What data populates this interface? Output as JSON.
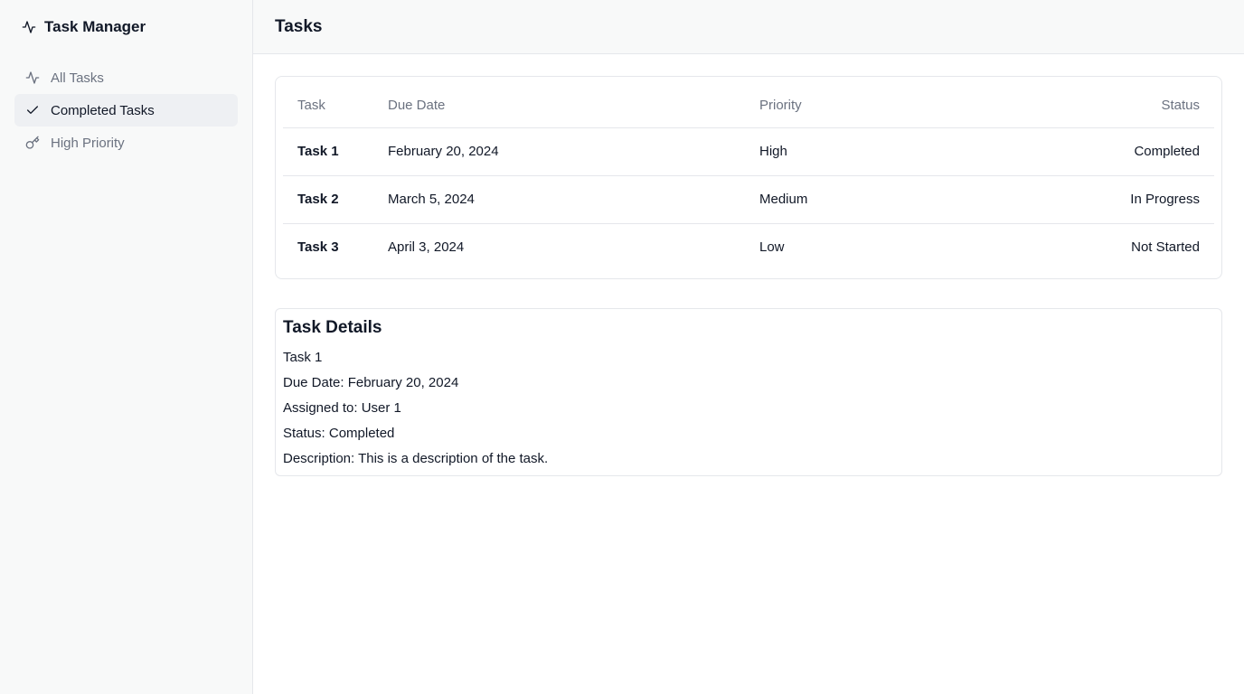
{
  "app": {
    "title": "Task Manager",
    "logo_icon": "activity-icon"
  },
  "sidebar": {
    "items": [
      {
        "label": "All Tasks",
        "icon": "activity-icon",
        "active": false
      },
      {
        "label": "Completed Tasks",
        "icon": "check-icon",
        "active": true
      },
      {
        "label": "High Priority",
        "icon": "key-icon",
        "active": false
      }
    ]
  },
  "header": {
    "title": "Tasks"
  },
  "table": {
    "columns": [
      "Task",
      "Due Date",
      "Priority",
      "Status"
    ],
    "rows": [
      {
        "task": "Task 1",
        "due": "February 20, 2024",
        "priority": "High",
        "status": "Completed"
      },
      {
        "task": "Task 2",
        "due": "March 5, 2024",
        "priority": "Medium",
        "status": "In Progress"
      },
      {
        "task": "Task 3",
        "due": "April 3, 2024",
        "priority": "Low",
        "status": "Not Started"
      }
    ]
  },
  "details": {
    "title": "Task Details",
    "name": "Task 1",
    "due": "Due Date: February 20, 2024",
    "assigned": "Assigned to: User 1",
    "status": "Status: Completed",
    "description": "Description: This is a description of the task."
  },
  "colors": {
    "sidebar_bg": "#f8f9f9",
    "active_bg": "#eef0f3",
    "muted_text": "#6b7280",
    "border": "#e5e7eb"
  }
}
